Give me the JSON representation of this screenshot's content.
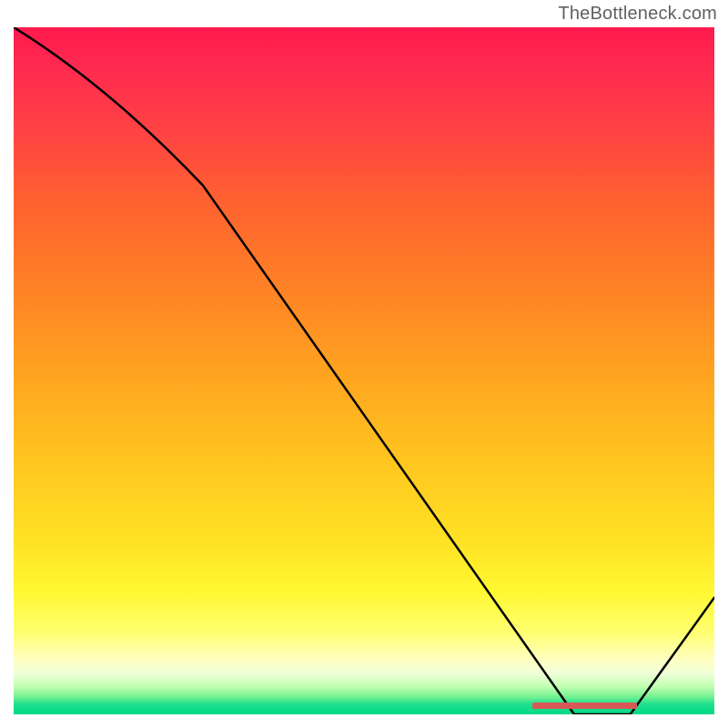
{
  "watermark": "TheBottleneck.com",
  "chart_data": {
    "type": "line",
    "title": "",
    "xlabel": "",
    "ylabel": "",
    "xlim": [
      0,
      100
    ],
    "ylim": [
      0,
      100
    ],
    "x": [
      0,
      27,
      80,
      88,
      100
    ],
    "values": [
      100,
      77,
      0,
      0,
      17
    ],
    "optimal_range_x": [
      74,
      89
    ],
    "background": "red-yellow-green vertical gradient",
    "annotations": []
  },
  "colors": {
    "curve": "#000000",
    "marker": "#d85858"
  }
}
